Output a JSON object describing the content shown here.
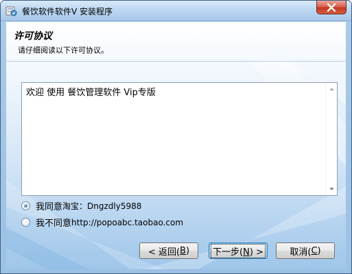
{
  "window": {
    "title": "餐饮软件软件V 安装程序",
    "icons": {
      "app": "installer-icon",
      "close": "close-icon"
    }
  },
  "header": {
    "title": "许可协议",
    "subtitle": "请仔细阅读以下许可协议。"
  },
  "license": {
    "text": "欢迎 使用 餐饮管理软件 Vip专版",
    "scroll_icons": [
      "scroll-up-arrow-icon",
      "scroll-down-arrow-icon"
    ]
  },
  "options": {
    "agree": {
      "label_cn": "我同意",
      "label_rest": " 淘宝：Dngzdly5988",
      "selected": true
    },
    "disagree": {
      "label_cn": "我不同意",
      "label_rest": " http://popoabc.taobao.com",
      "selected": false
    }
  },
  "buttons": {
    "back": {
      "pre": "< 返回(",
      "key": "B",
      "post": ")"
    },
    "next": {
      "pre": "下一步(",
      "key": "N",
      "post": ") >"
    },
    "cancel": {
      "pre": "取消(",
      "key": "C",
      "post": ")"
    }
  },
  "colors": {
    "frame": "#a8c8ea",
    "close": "#c23a22",
    "accent": "#3c7fb1"
  }
}
